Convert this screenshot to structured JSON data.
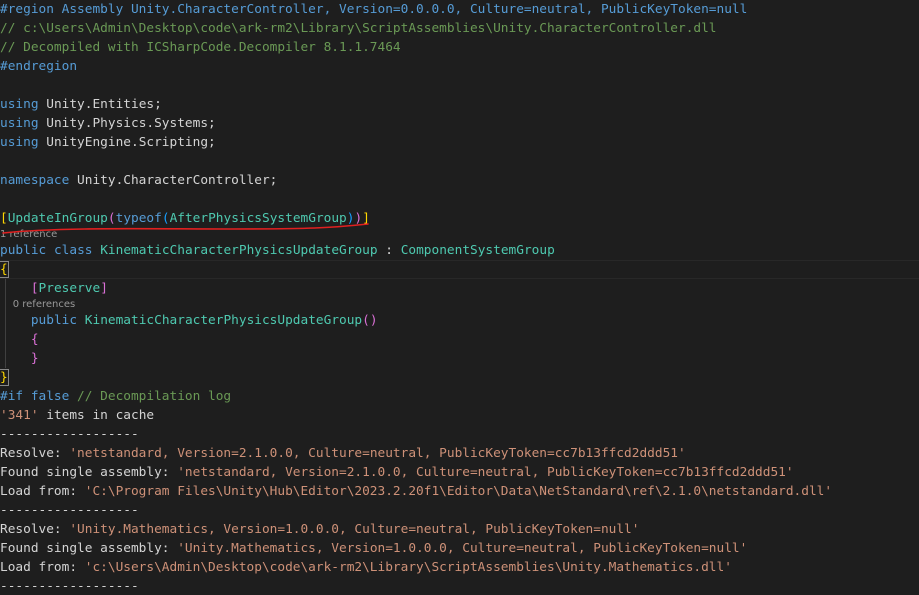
{
  "theme": {
    "background": "#1e1e1e",
    "colors": {
      "keyword": "#569cd6",
      "control": "#c586c0",
      "type": "#4ec9b0",
      "method": "#dcdcaa",
      "string": "#ce9178",
      "comment": "#6a9955",
      "plain": "#d4d4d4",
      "bracket_gold": "#ffd700",
      "bracket_purple": "#da70d6",
      "bracket_blue": "#179fff",
      "codelens": "#999999",
      "annotation": "#e02020"
    }
  },
  "lines": [
    {
      "tokens": [
        {
          "t": "#region Assembly Unity.CharacterController, Version=0.0.0.0, Culture=neutral, PublicKeyToken=null",
          "c": "keyword"
        }
      ]
    },
    {
      "tokens": [
        {
          "t": "// c:\\Users\\Admin\\Desktop\\code\\ark-rm2\\Library\\ScriptAssemblies\\Unity.CharacterController.dll",
          "c": "comment"
        }
      ]
    },
    {
      "tokens": [
        {
          "t": "// Decompiled with ICSharpCode.Decompiler 8.1.1.7464",
          "c": "comment"
        }
      ]
    },
    {
      "tokens": [
        {
          "t": "#endregion",
          "c": "keyword"
        }
      ]
    },
    {
      "tokens": []
    },
    {
      "tokens": [
        {
          "t": "using",
          "c": "keyword"
        },
        {
          "t": " Unity.Entities;",
          "c": "plain"
        }
      ]
    },
    {
      "tokens": [
        {
          "t": "using",
          "c": "keyword"
        },
        {
          "t": " Unity.Physics.Systems;",
          "c": "plain"
        }
      ]
    },
    {
      "tokens": [
        {
          "t": "using",
          "c": "keyword"
        },
        {
          "t": " UnityEngine.Scripting;",
          "c": "plain"
        }
      ]
    },
    {
      "tokens": []
    },
    {
      "tokens": [
        {
          "t": "namespace",
          "c": "keyword"
        },
        {
          "t": " Unity.CharacterController;",
          "c": "plain"
        }
      ]
    },
    {
      "tokens": []
    },
    {
      "tokens": [
        {
          "t": "[",
          "c": "bracket_gold"
        },
        {
          "t": "UpdateInGroup",
          "c": "type"
        },
        {
          "t": "(",
          "c": "bracket_purple"
        },
        {
          "t": "typeof",
          "c": "keyword"
        },
        {
          "t": "(",
          "c": "bracket_blue"
        },
        {
          "t": "AfterPhysicsSystemGroup",
          "c": "type"
        },
        {
          "t": ")",
          "c": "bracket_blue"
        },
        {
          "t": ")",
          "c": "bracket_purple"
        },
        {
          "t": "]",
          "c": "bracket_gold"
        }
      ]
    },
    {
      "lens": "1 reference"
    },
    {
      "tokens": [
        {
          "t": "public",
          "c": "keyword"
        },
        {
          "t": " ",
          "c": "plain"
        },
        {
          "t": "class",
          "c": "keyword"
        },
        {
          "t": " ",
          "c": "plain"
        },
        {
          "t": "KinematicCharacterPhysicsUpdateGroup",
          "c": "type"
        },
        {
          "t": " : ",
          "c": "plain"
        },
        {
          "t": "ComponentSystemGroup",
          "c": "type"
        }
      ]
    },
    {
      "tokens": [
        {
          "t": "{",
          "c": "bracket_gold",
          "box": true
        }
      ],
      "current": true
    },
    {
      "tokens": [
        {
          "t": "    ",
          "c": "plain"
        },
        {
          "t": "[",
          "c": "bracket_purple"
        },
        {
          "t": "Preserve",
          "c": "type"
        },
        {
          "t": "]",
          "c": "bracket_purple"
        }
      ]
    },
    {
      "lens": "    0 references"
    },
    {
      "tokens": [
        {
          "t": "    ",
          "c": "plain"
        },
        {
          "t": "public",
          "c": "keyword"
        },
        {
          "t": " ",
          "c": "plain"
        },
        {
          "t": "KinematicCharacterPhysicsUpdateGroup",
          "c": "type"
        },
        {
          "t": "()",
          "c": "bracket_purple"
        }
      ]
    },
    {
      "tokens": [
        {
          "t": "    ",
          "c": "plain"
        },
        {
          "t": "{",
          "c": "bracket_purple"
        }
      ]
    },
    {
      "tokens": [
        {
          "t": "    ",
          "c": "plain"
        },
        {
          "t": "}",
          "c": "bracket_purple"
        }
      ]
    },
    {
      "tokens": [
        {
          "t": "}",
          "c": "bracket_gold",
          "box": true
        }
      ]
    },
    {
      "tokens": [
        {
          "t": "#if false",
          "c": "keyword"
        },
        {
          "t": " // Decompilation log",
          "c": "comment"
        }
      ]
    },
    {
      "tokens": [
        {
          "t": "'341'",
          "c": "string"
        },
        {
          "t": " items in cache",
          "c": "plain"
        }
      ]
    },
    {
      "tokens": [
        {
          "t": "------------------",
          "c": "plain"
        }
      ]
    },
    {
      "tokens": [
        {
          "t": "Resolve: ",
          "c": "plain"
        },
        {
          "t": "'netstandard, Version=2.1.0.0, Culture=neutral, PublicKeyToken=cc7b13ffcd2ddd51'",
          "c": "string"
        }
      ]
    },
    {
      "tokens": [
        {
          "t": "Found single assembly: ",
          "c": "plain"
        },
        {
          "t": "'netstandard, Version=2.1.0.0, Culture=neutral, PublicKeyToken=cc7b13ffcd2ddd51'",
          "c": "string"
        }
      ]
    },
    {
      "tokens": [
        {
          "t": "Load from: ",
          "c": "plain"
        },
        {
          "t": "'C:\\Program Files\\Unity\\Hub\\Editor\\2023.2.20f1\\Editor\\Data\\NetStandard\\ref\\2.1.0\\netstandard.dll'",
          "c": "string"
        }
      ]
    },
    {
      "tokens": [
        {
          "t": "------------------",
          "c": "plain"
        }
      ]
    },
    {
      "tokens": [
        {
          "t": "Resolve: ",
          "c": "plain"
        },
        {
          "t": "'Unity.Mathematics, Version=1.0.0.0, Culture=neutral, PublicKeyToken=null'",
          "c": "string"
        }
      ]
    },
    {
      "tokens": [
        {
          "t": "Found single assembly: ",
          "c": "plain"
        },
        {
          "t": "'Unity.Mathematics, Version=1.0.0.0, Culture=neutral, PublicKeyToken=null'",
          "c": "string"
        }
      ]
    },
    {
      "tokens": [
        {
          "t": "Load from: ",
          "c": "plain"
        },
        {
          "t": "'c:\\Users\\Admin\\Desktop\\code\\ark-rm2\\Library\\ScriptAssemblies\\Unity.Mathematics.dll'",
          "c": "string"
        }
      ]
    },
    {
      "tokens": [
        {
          "t": "------------------",
          "c": "plain"
        }
      ]
    }
  ]
}
